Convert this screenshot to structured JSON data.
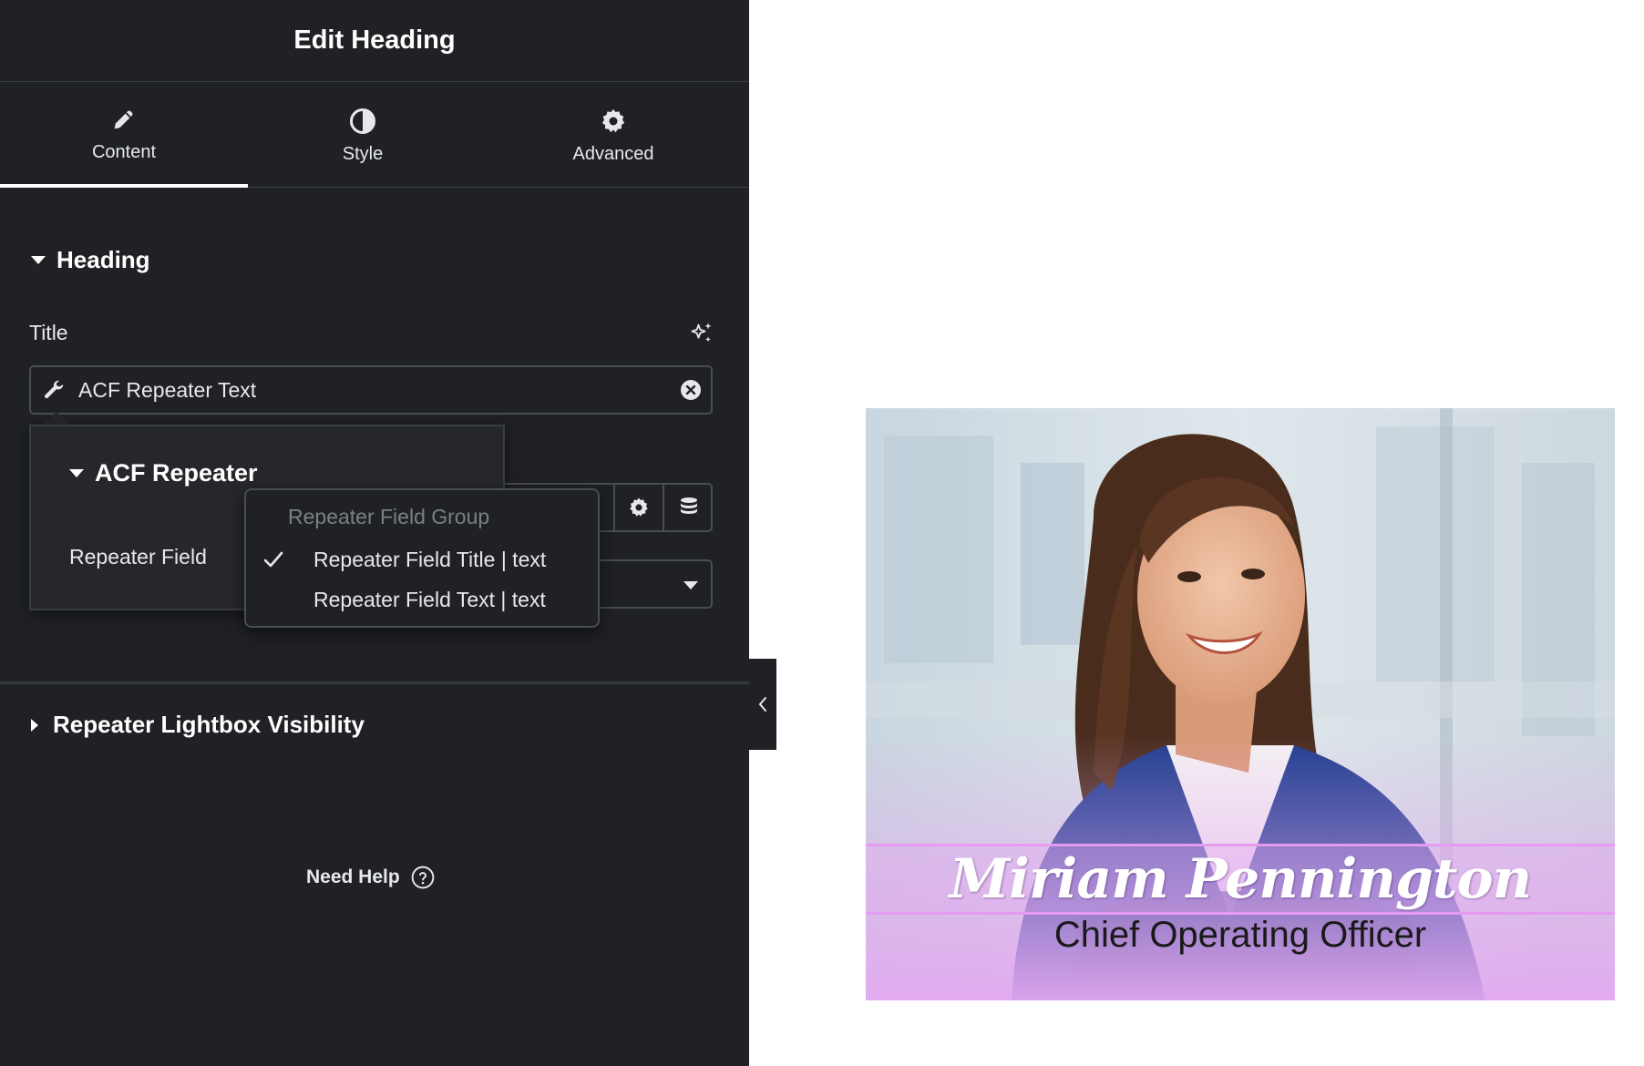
{
  "panel": {
    "title": "Edit Heading",
    "tabs": [
      {
        "label": "Content",
        "icon": "pencil-icon",
        "active": true
      },
      {
        "label": "Style",
        "icon": "half-circle-icon",
        "active": false
      },
      {
        "label": "Advanced",
        "icon": "gear-icon",
        "active": false
      }
    ],
    "heading_section": "Heading",
    "title_label": "Title",
    "title_field_value": "ACF Repeater Text",
    "acf_popup": {
      "section_title": "ACF Repeater",
      "field_label": "Repeater Field"
    },
    "dropdown": {
      "group_label": "Repeater Field Group",
      "options": [
        {
          "label": "Repeater Field Title | text",
          "selected": true
        },
        {
          "label": "Repeater Field Text | text",
          "selected": false
        }
      ]
    },
    "lightbox_section": "Repeater Lightbox Visibility",
    "need_help": "Need Help"
  },
  "preview": {
    "name": "Miriam Pennington",
    "role": "Chief Operating Officer"
  },
  "colors": {
    "panel_bg": "#1f2124",
    "accent_band": "#e59cf0",
    "gradient_bottom": "#e3a8f0"
  }
}
